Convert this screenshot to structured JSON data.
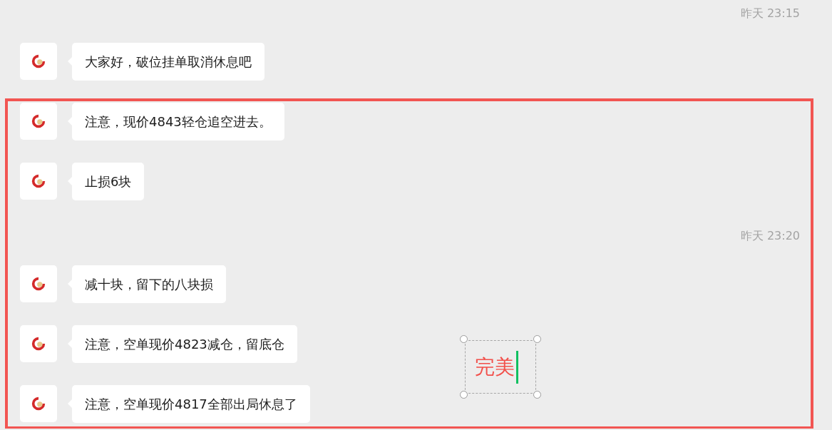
{
  "messages": [
    {
      "kind": "time",
      "text": "昨天 23:15"
    },
    {
      "kind": "message",
      "text": "大家好，破位挂单取消休息吧"
    },
    {
      "kind": "message",
      "text": "注意，现价4843轻仓追空进去。"
    },
    {
      "kind": "message",
      "text": "止损6块"
    },
    {
      "kind": "time",
      "text": "昨天 23:20"
    },
    {
      "kind": "message",
      "text": "减十块，留下的八块损"
    },
    {
      "kind": "message",
      "text": "注意，空单现价4823减仓，留底仓"
    },
    {
      "kind": "message",
      "text": "注意，空单现价4817全部出局休息了"
    }
  ],
  "annotation": {
    "text": "完美"
  }
}
